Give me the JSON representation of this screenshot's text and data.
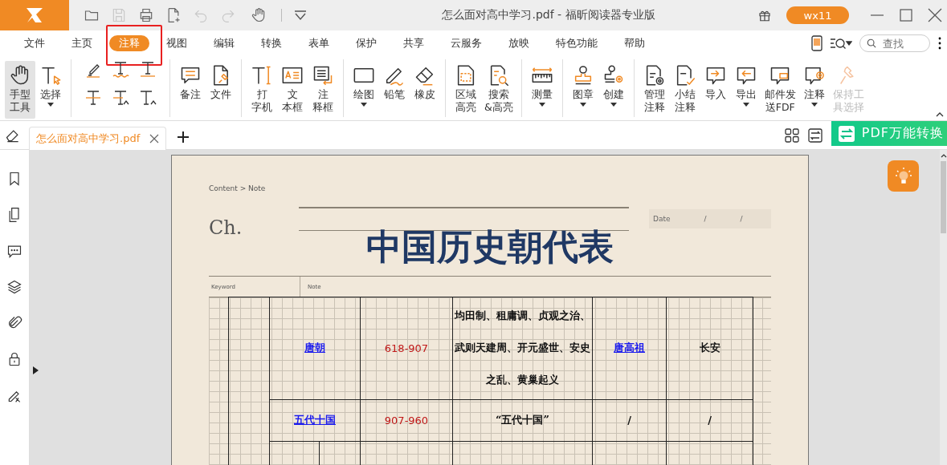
{
  "window": {
    "title": "怎么面对高中学习.pdf - 福昕阅读器专业版",
    "user": "wx11"
  },
  "quick_toolbar": [
    {
      "disabled": false
    },
    {
      "disabled": true
    },
    {
      "disabled": false
    },
    {
      "disabled": false
    },
    {
      "disabled": true
    },
    {
      "disabled": true
    },
    {
      "disabled": false
    }
  ],
  "menu": {
    "tabs": [
      {
        "label": "文件",
        "selected": false,
        "highlighted": false
      },
      {
        "label": "主页",
        "selected": false,
        "highlighted": false
      },
      {
        "label": "注释",
        "selected": true,
        "highlighted": true
      },
      {
        "label": "视图",
        "selected": false,
        "highlighted": false
      },
      {
        "label": "编辑",
        "selected": false,
        "highlighted": false
      },
      {
        "label": "转换",
        "selected": false,
        "highlighted": false
      },
      {
        "label": "表单",
        "selected": false,
        "highlighted": false
      },
      {
        "label": "保护",
        "selected": false,
        "highlighted": false
      },
      {
        "label": "共享",
        "selected": false,
        "highlighted": false
      },
      {
        "label": "云服务",
        "selected": false,
        "highlighted": false
      },
      {
        "label": "放映",
        "selected": false,
        "highlighted": false
      },
      {
        "label": "特色功能",
        "selected": false,
        "highlighted": false
      },
      {
        "label": "帮助",
        "selected": false,
        "highlighted": false
      }
    ],
    "search": {
      "placeholder": "查找"
    }
  },
  "ribbon": {
    "groups": [
      {
        "kind": "row",
        "tools": [
          {
            "lines": [
              "手型",
              "工具"
            ],
            "selected": true,
            "disabled": false,
            "dropdown": false
          },
          {
            "lines": [
              "选择"
            ],
            "selected": false,
            "disabled": false,
            "dropdown": true
          }
        ]
      },
      {
        "kind": "grid"
      },
      {
        "kind": "row",
        "tools": [
          {
            "lines": [
              "备注"
            ],
            "selected": false,
            "disabled": false,
            "dropdown": false
          },
          {
            "lines": [
              "文件"
            ],
            "selected": false,
            "disabled": false,
            "dropdown": false
          }
        ]
      },
      {
        "kind": "row",
        "tools": [
          {
            "lines": [
              "打",
              "字机"
            ],
            "selected": false,
            "disabled": false,
            "dropdown": false
          },
          {
            "lines": [
              "文",
              "本框"
            ],
            "selected": false,
            "disabled": false,
            "dropdown": false
          },
          {
            "lines": [
              "注",
              "释框"
            ],
            "selected": false,
            "disabled": false,
            "dropdown": false
          }
        ]
      },
      {
        "kind": "row",
        "tools": [
          {
            "lines": [
              "绘图"
            ],
            "selected": false,
            "disabled": false,
            "dropdown": true
          },
          {
            "lines": [
              "铅笔"
            ],
            "selected": false,
            "disabled": false,
            "dropdown": false
          },
          {
            "lines": [
              "橡皮"
            ],
            "selected": false,
            "disabled": false,
            "dropdown": false
          }
        ]
      },
      {
        "kind": "row",
        "tools": [
          {
            "lines": [
              "区域",
              "高亮"
            ],
            "selected": false,
            "disabled": false,
            "dropdown": false
          },
          {
            "lines": [
              "搜索",
              "&高亮"
            ],
            "selected": false,
            "disabled": false,
            "dropdown": false
          }
        ]
      },
      {
        "kind": "row",
        "tools": [
          {
            "lines": [
              "测量"
            ],
            "selected": false,
            "disabled": false,
            "dropdown": true
          }
        ]
      },
      {
        "kind": "row",
        "tools": [
          {
            "lines": [
              "图章"
            ],
            "selected": false,
            "disabled": false,
            "dropdown": true
          },
          {
            "lines": [
              "创建"
            ],
            "selected": false,
            "disabled": false,
            "dropdown": true
          }
        ]
      },
      {
        "kind": "row",
        "tools": [
          {
            "lines": [
              "管理",
              "注释"
            ],
            "selected": false,
            "disabled": false,
            "dropdown": false
          },
          {
            "lines": [
              "小结",
              "注释"
            ],
            "selected": false,
            "disabled": false,
            "dropdown": false
          },
          {
            "lines": [
              "导入"
            ],
            "selected": false,
            "disabled": false,
            "dropdown": false
          },
          {
            "lines": [
              "导出"
            ],
            "selected": false,
            "disabled": false,
            "dropdown": true
          },
          {
            "lines": [
              "邮件发",
              "送FDF"
            ],
            "selected": false,
            "disabled": false,
            "dropdown": false
          },
          {
            "lines": [
              "注释"
            ],
            "selected": false,
            "disabled": false,
            "dropdown": true
          },
          {
            "lines": [
              "保持工",
              "具选择"
            ],
            "selected": false,
            "disabled": true,
            "dropdown": false
          }
        ]
      }
    ]
  },
  "doc_tabs": [
    {
      "label": "怎么面对高中学习.pdf",
      "selected": true
    }
  ],
  "banner": {
    "label": "PDF万能转换"
  },
  "document": {
    "breadcrumb": "Content > Note",
    "chapter": "Ch.",
    "date_label": "Date",
    "date_separators": [
      "/",
      "/"
    ],
    "title": "中国历史朝代表",
    "columns": [
      "Keyword",
      "Note"
    ],
    "rows": [
      {
        "kind": "full",
        "dynasty": "唐朝",
        "years": "618-907",
        "events": "均田制、租庸调、贞观之治、武则天建周、开元盛世、安史之乱、黄巢起义",
        "founder": "唐高祖",
        "founder_link": true,
        "capital": "长安"
      },
      {
        "kind": "full",
        "dynasty": "五代十国",
        "years": "907-960",
        "events": "“五代十国”",
        "founder": "/",
        "founder_link": false,
        "capital": "/"
      },
      {
        "kind": "split"
      }
    ]
  }
}
